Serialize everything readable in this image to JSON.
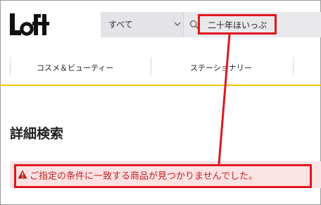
{
  "brand": {
    "logo_text": "Loft"
  },
  "search": {
    "category_value": "すべて",
    "query_value": "二十年ほいっぷ"
  },
  "nav": {
    "items": [
      {
        "label": "コスメ＆ビューティー"
      },
      {
        "label": "ステーショナリー"
      }
    ]
  },
  "main": {
    "page_title": "詳細検索",
    "alert_message": "ご指定の条件に一致する商品が見つかりませんでした。"
  },
  "colors": {
    "annotation_red": "#e0161f",
    "accent_yellow": "#f6c600",
    "alert_background": "#fbe3e3",
    "alert_text": "#c22020"
  }
}
